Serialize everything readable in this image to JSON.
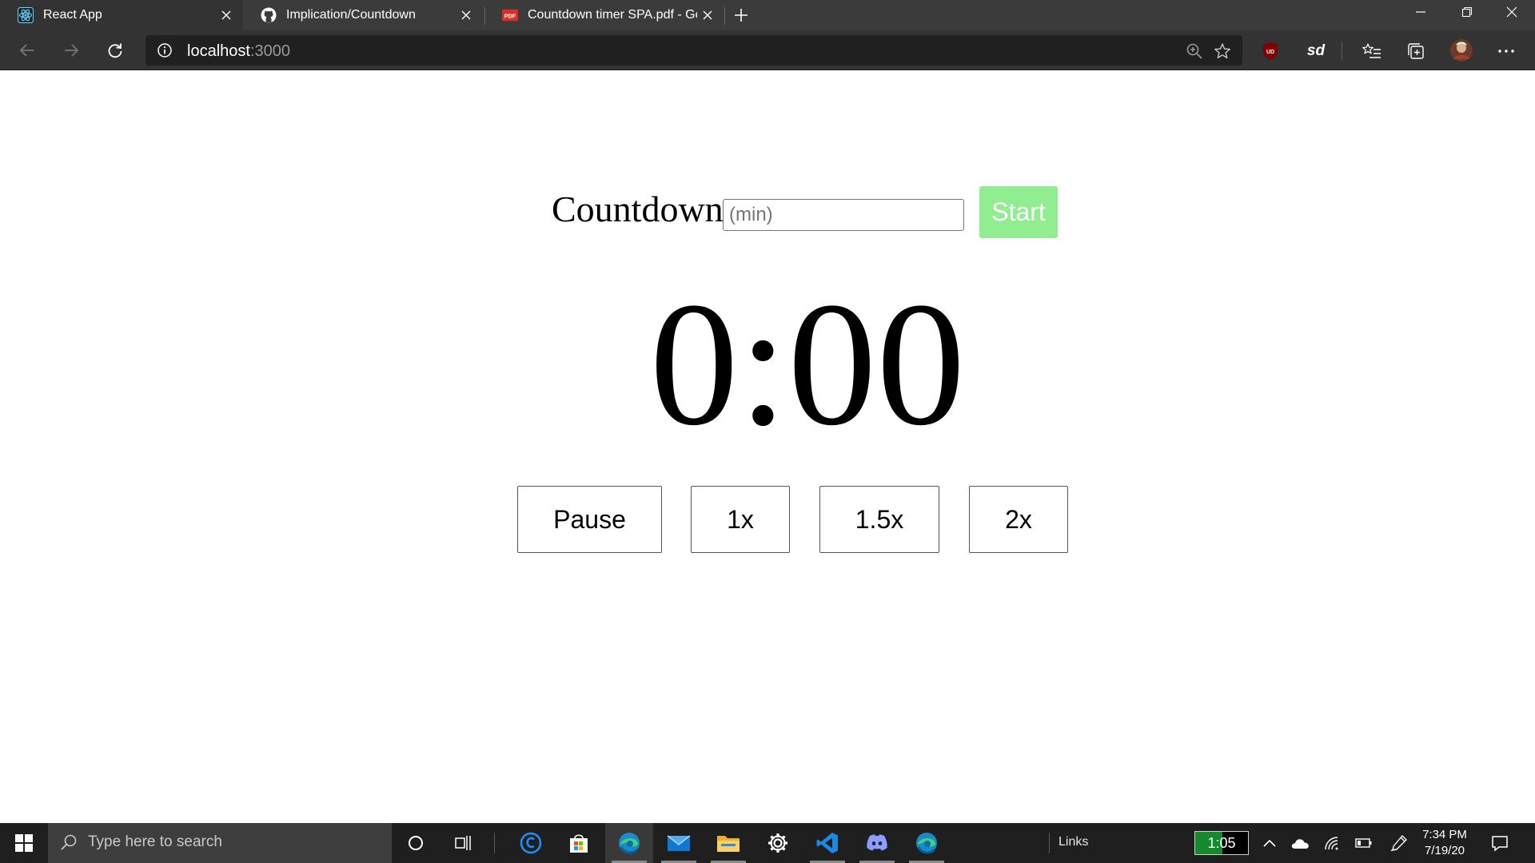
{
  "browser": {
    "tabs": [
      {
        "title": "React App",
        "active": true
      },
      {
        "title": "Implication/Countdown",
        "active": false
      },
      {
        "title": "Countdown timer SPA.pdf - Goo",
        "active": false
      }
    ],
    "pdf_badge": "PDF",
    "url_host": "localhost",
    "url_port": ":3000",
    "extensions": {
      "ublock_badge": "UD",
      "sd_badge": "sd"
    }
  },
  "app": {
    "countdown_label": "Countdown:",
    "minutes_placeholder": "(min)",
    "minutes_value": "",
    "start_label": "Start",
    "time_display": "0:00",
    "controls": {
      "pause_label": "Pause",
      "speed_1x_label": "1x",
      "speed_1_5x_label": "1.5x",
      "speed_2x_label": "2x"
    },
    "colors": {
      "start_button": "#90ee90"
    }
  },
  "taskbar": {
    "search_placeholder": "Type here to search",
    "links_label": "Links",
    "timer_widget": "1:05",
    "timer_widget_progress": 0.52,
    "clock_time": "7:34 PM",
    "clock_date": "7/19/20"
  }
}
